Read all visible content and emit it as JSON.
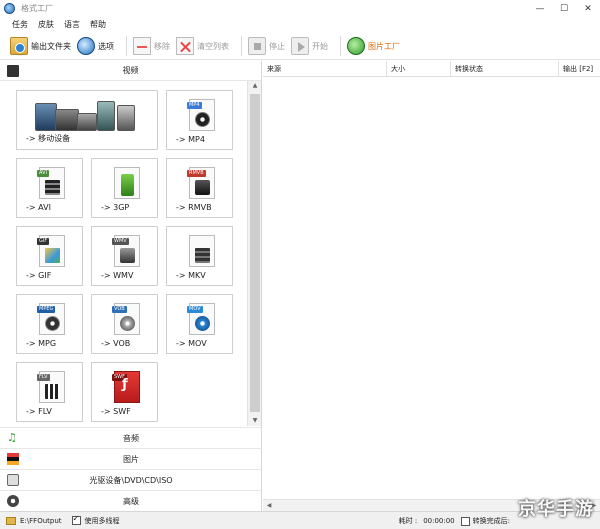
{
  "window": {
    "title": "格式工厂"
  },
  "menu": [
    "任务",
    "皮肤",
    "语言",
    "帮助"
  ],
  "toolbar": {
    "output_folder": "输出文件夹",
    "options": "选项",
    "remove": "移除",
    "clear_list": "清空列表",
    "stop": "停止",
    "start": "开始",
    "picture_factory": "图片工厂"
  },
  "left_panel": {
    "video_category": "视频",
    "tiles": [
      {
        "label": "-> 移动设备",
        "kind": "mobile"
      },
      {
        "label": "-> MP4",
        "tag": "MP4",
        "color": "#3a7bd5"
      },
      {
        "label": "-> AVI",
        "tag": "AVI",
        "color": "#4b8f3a"
      },
      {
        "label": "-> 3GP",
        "tag": "",
        "color": "#5fa82d"
      },
      {
        "label": "-> RMVB",
        "tag": "RMVB",
        "color": "#c0392b"
      },
      {
        "label": "-> GIF",
        "tag": "GIF",
        "color": "#333333"
      },
      {
        "label": "-> WMV",
        "tag": "WMV",
        "color": "#555555"
      },
      {
        "label": "-> MKV",
        "tag": "",
        "color": "#7a6a5a"
      },
      {
        "label": "-> MPG",
        "tag": "MPEG",
        "color": "#1e5fa8"
      },
      {
        "label": "-> VOB",
        "tag": "VOB",
        "color": "#2f6fb8"
      },
      {
        "label": "-> MOV",
        "tag": "MOV",
        "color": "#2a8ad8"
      },
      {
        "label": "-> FLV",
        "tag": "FLV",
        "color": "#666666"
      },
      {
        "label": "-> SWF",
        "tag": "SWF",
        "color": "#c62828"
      }
    ],
    "bottom_categories": [
      "音频",
      "图片",
      "光驱设备\\DVD\\CD\\ISO",
      "高级"
    ]
  },
  "task_table": {
    "columns": [
      "来源",
      "大小",
      "转换状态",
      "输出 [F2]"
    ]
  },
  "statusbar": {
    "output_path": "E:\\FFOutput",
    "multithread_label": "使用多线程",
    "elapsed_label": "耗时 :",
    "elapsed_value": "00:00:00",
    "after_label": "转换完成后:"
  },
  "watermark": "京华手游"
}
